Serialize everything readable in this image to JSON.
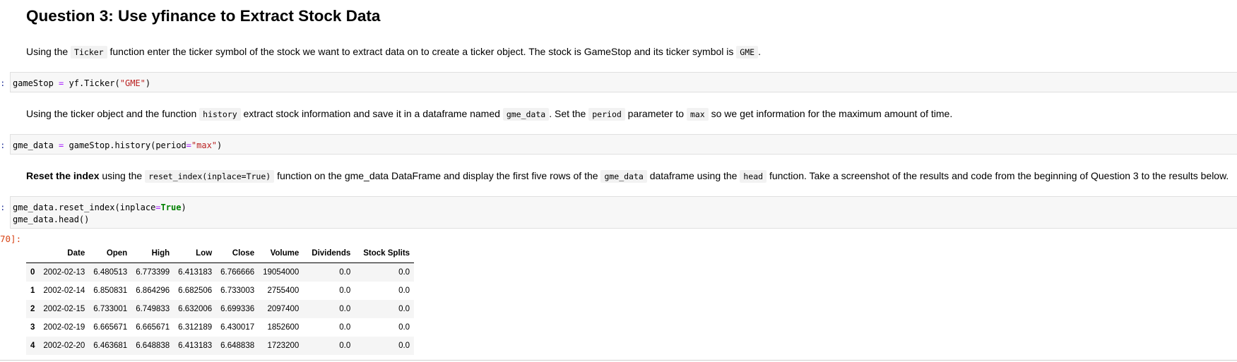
{
  "heading": "Question 3: Use yfinance to Extract Stock Data",
  "p1": {
    "t1": "Using the ",
    "c1": "Ticker",
    "t2": " function enter the ticker symbol of the stock we want to extract data on to create a ticker object. The stock is GameStop and its ticker symbol is ",
    "c2": "GME",
    "t3": "."
  },
  "cell1": {
    "prompt": ":",
    "var": "gameStop",
    "eq": "=",
    "call_open": "yf.Ticker(",
    "arg": "\"GME\"",
    "call_close": ")"
  },
  "p2": {
    "t1": "Using the ticker object and the function ",
    "c1": "history",
    "t2": " extract stock information and save it in a dataframe named ",
    "c2": "gme_data",
    "t3": ". Set the ",
    "c3": "period",
    "t4": " parameter to ",
    "c4": "max",
    "t5": " so we get information for the maximum amount of time."
  },
  "cell2": {
    "prompt": ":",
    "var": "gme_data",
    "eq": "=",
    "call_open": "gameStop.history(period",
    "eq2": "=",
    "arg": "\"max\"",
    "call_close": ")"
  },
  "p3": {
    "bold": "Reset the index",
    "t1": " using the ",
    "c1": "reset_index(inplace=True)",
    "t2": " function on the gme_data DataFrame and display the first five rows of the ",
    "c2": "gme_data",
    "t3": " dataframe using the ",
    "c3": "head",
    "t4": " function. Take a screenshot of the results and code from the beginning of Question 3 to the results below."
  },
  "cell3": {
    "prompt": ":",
    "line1_a": "gme_data.reset_index(inplace",
    "line1_eq": "=",
    "line1_kw": "True",
    "line1_b": ")",
    "line2": "gme_data.head()",
    "out_prompt": "70]:"
  },
  "table": {
    "columns": [
      "",
      "Date",
      "Open",
      "High",
      "Low",
      "Close",
      "Volume",
      "Dividends",
      "Stock Splits"
    ],
    "rows": [
      [
        "0",
        "2002-02-13",
        "6.480513",
        "6.773399",
        "6.413183",
        "6.766666",
        "19054000",
        "0.0",
        "0.0"
      ],
      [
        "1",
        "2002-02-14",
        "6.850831",
        "6.864296",
        "6.682506",
        "6.733003",
        "2755400",
        "0.0",
        "0.0"
      ],
      [
        "2",
        "2002-02-15",
        "6.733001",
        "6.749833",
        "6.632006",
        "6.699336",
        "2097400",
        "0.0",
        "0.0"
      ],
      [
        "3",
        "2002-02-19",
        "6.665671",
        "6.665671",
        "6.312189",
        "6.430017",
        "1852600",
        "0.0",
        "0.0"
      ],
      [
        "4",
        "2002-02-20",
        "6.463681",
        "6.648838",
        "6.413183",
        "6.648838",
        "1723200",
        "0.0",
        "0.0"
      ]
    ]
  }
}
